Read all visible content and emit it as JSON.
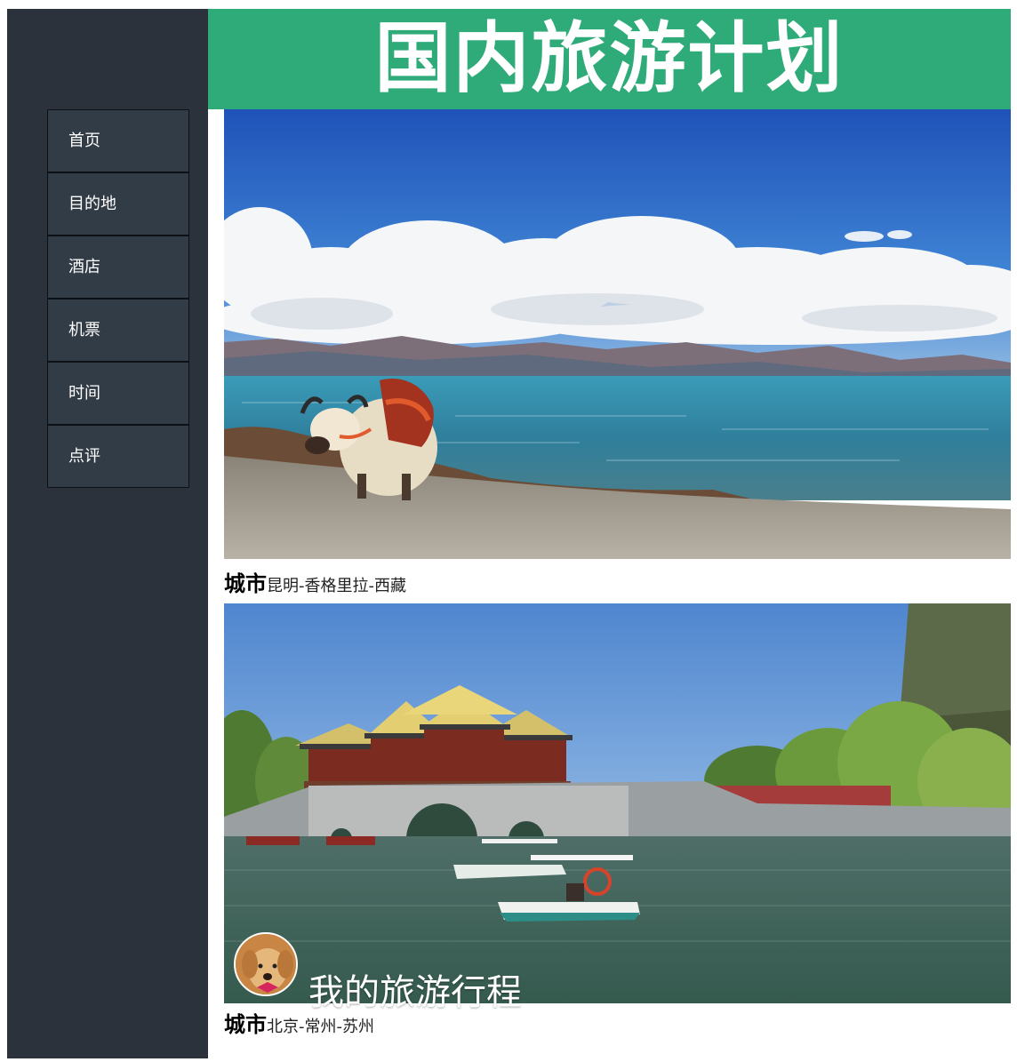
{
  "header": {
    "title": "国内旅游计划"
  },
  "nav": {
    "items": [
      {
        "label": "首页"
      },
      {
        "label": "目的地"
      },
      {
        "label": "酒店"
      },
      {
        "label": "机票"
      },
      {
        "label": "时间"
      },
      {
        "label": "点评"
      }
    ]
  },
  "cards": [
    {
      "caption_key": "城市",
      "caption_value": "昆明-香格里拉-西藏"
    },
    {
      "caption_key": "城市",
      "caption_value": "北京-常州-苏州",
      "overlay_title": "我的旅游行程"
    }
  ],
  "colors": {
    "sidebar": "#2b323b",
    "nav_item": "#323c46",
    "header": "#2eab78"
  }
}
